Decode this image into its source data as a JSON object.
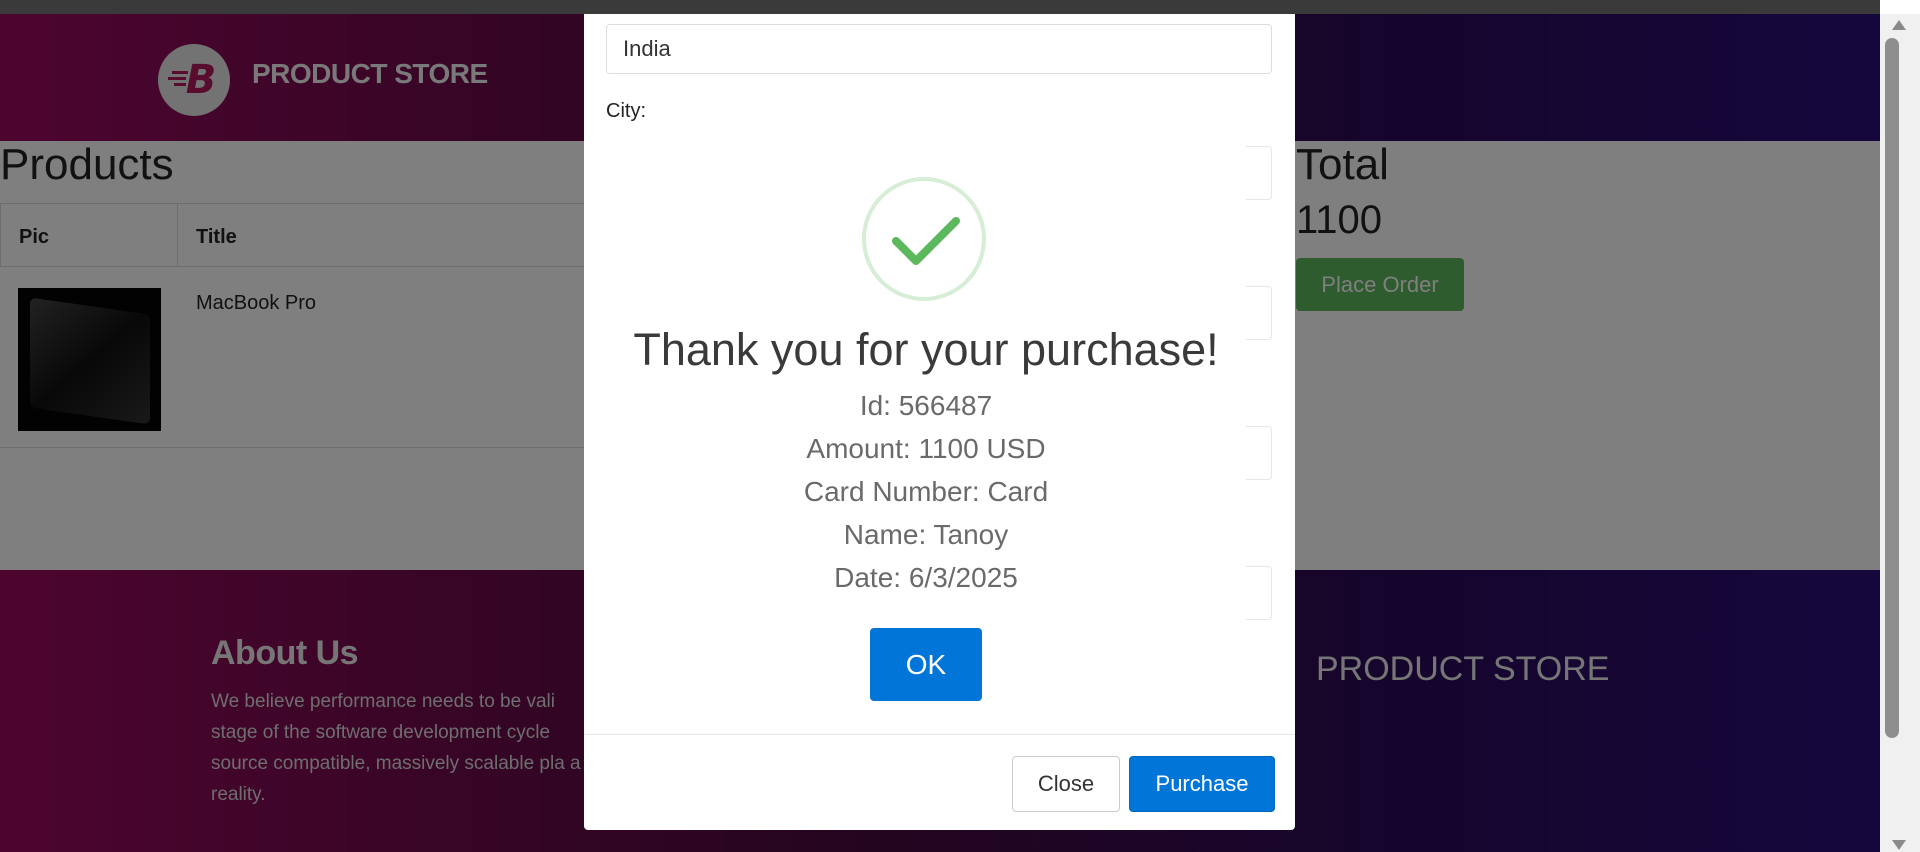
{
  "header": {
    "brand": "PRODUCT STORE"
  },
  "cart": {
    "heading": "Products",
    "columns": [
      "Pic",
      "Title"
    ],
    "rows": [
      {
        "title": "MacBook Pro"
      }
    ],
    "total_heading": "Total",
    "total_value": "1100",
    "place_order": "Place Order"
  },
  "footer": {
    "about_heading": "About Us",
    "about_text": "We believe performance needs to be vali stage of the software development cycle source compatible, massively scalable pla a reality.",
    "brand": "PRODUCT STORE"
  },
  "order_modal": {
    "country_value": "India",
    "city_label": "City:",
    "close_label": "Close",
    "purchase_label": "Purchase"
  },
  "confirmation": {
    "title": "Thank you for your purchase!",
    "id_line": "Id: 566487",
    "amount_line": "Amount: 1100 USD",
    "card_line": "Card Number: Card",
    "name_line": "Name: Tanoy",
    "date_line": "Date: 6/3/2025",
    "ok_label": "OK",
    "success_color": "#5cb85c"
  }
}
